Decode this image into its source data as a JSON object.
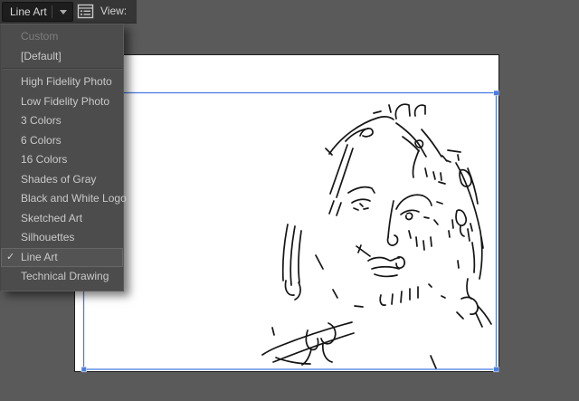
{
  "toolbar": {
    "preset_value": "Line Art",
    "view_label": "View:"
  },
  "menu": {
    "items": [
      {
        "label": "Custom",
        "disabled": true
      },
      {
        "label": "[Default]"
      },
      {
        "separator": true
      },
      {
        "label": "High Fidelity Photo"
      },
      {
        "label": "Low Fidelity Photo"
      },
      {
        "label": "3 Colors"
      },
      {
        "label": "6 Colors"
      },
      {
        "label": "16 Colors"
      },
      {
        "label": "Shades of Gray"
      },
      {
        "label": "Black and White Logo"
      },
      {
        "label": "Sketched Art"
      },
      {
        "label": "Silhouettes"
      },
      {
        "label": "Line Art",
        "checked": true,
        "selected": true
      },
      {
        "label": "Technical Drawing"
      }
    ],
    "checkmark_glyph": "✓"
  },
  "icons": {
    "panel_icon": "image-trace-panel-icon",
    "dropdown_arrow": "chevron-down-icon"
  },
  "colors": {
    "selection_blue": "#4a7de2",
    "canvas_gray": "#5a5a5a",
    "toolbar_bg": "#363636",
    "menu_bg": "#4c4c4c",
    "artboard_white": "#ffffff",
    "sketch_ink": "#151515"
  },
  "canvas": {
    "sketch_paths": [
      "M364,170 C377,151 398,136 418,130 C425,128 431,129 435,132",
      "M360,164 L367,171",
      "M382,156 C390,147 400,143 407,142",
      "M398,150 C401,142 410,139 412,145 C413,150 405,152 401,150",
      "M413,125 L421,123",
      "M430,116 L432,124",
      "M438,131 C435,119 444,113 452,116 L453,128",
      "M459,128 C457,119 464,114 470,117 L470,126",
      "M438,136 C448,143 458,152 464,161 C467,166 469,170 471,173",
      "M445,151 C452,156 459,162 463,167",
      "M459,157 C464,153 469,156 467,161 C465,165 460,163 459,158",
      "M466,143 C474,152 482,163 488,173",
      "M489,172 L494,178",
      "M463,166 C459,176 455,186 457,196",
      "M470,186 L472,195",
      "M479,190 L481,198",
      "M487,191 L488,199",
      "M485,201 L492,203",
      "M493,177 L498,179",
      "M495,166 L509,168",
      "M506,171 L507,177",
      "M504,180 C514,197 525,226 531,256 C534,276 533,293 530,308",
      "M509,188 C515,186 521,193 521,201 C520,207 513,208 510,202 C508,196 507,191 509,188",
      "M517,186 C522,198 526,212 528,225",
      "M505,233 C503,240 504,247 509,249 C514,250 517,244 514,238 C512,232 507,231 505,233",
      "M509,250 C508,256 510,260 513,261",
      "M500,243 L501,252",
      "M520,247 L522,255",
      "M517,253 L519,266",
      "M522,268 C524,279 525,291 524,301",
      "M506,288 L507,296",
      "M532,262 L534,274",
      "M384,160 L365,214",
      "M390,164 L372,218",
      "M369,222 L364,236",
      "M377,224 L372,238",
      "M318,248 C314,268 312,290 313,310",
      "M326,250 C322,272 320,295 322,315",
      "M333,255 C330,276 329,296 331,312",
      "M316,310 C314,320 318,327 325,326",
      "M330,312 C334,320 332,328 326,331",
      "M349,282 L357,297",
      "M368,320 L373,329",
      "M385,213 C394,207 404,205 411,208 L414,213",
      "M389,224 C395,220 403,219 409,222",
      "M398,225 L401,228",
      "M391,230 L396,232",
      "M402,231 L407,230",
      "M438,231 C443,220 455,213 467,216 C472,218 476,222 477,227",
      "M443,237 C449,232 457,231 463,234",
      "M450,236 C454,234 457,237 455,241 C452,244 448,242 449,238",
      "M469,240 L474,241",
      "M483,223 L489,225",
      "M480,243 L484,248",
      "M435,222 C432,236 430,250 429,262",
      "M429,262 C427,269 432,273 437,270 C441,267 440,261 436,260",
      "M452,255 L454,263",
      "M460,262 L461,272",
      "M468,266 L469,276",
      "M476,262 L477,272",
      "M496,255 L497,262",
      "M394,272 L409,283",
      "M399,271 L396,279",
      "M407,288 C415,283 424,284 429,287 C433,290 437,284 441,285",
      "M440,284 C446,283 449,289 446,294 C442,298 438,296 438,291",
      "M411,297 C420,294 432,294 441,297",
      "M414,303 C422,306 431,306 439,304",
      "M421,326 C419,333 421,338 426,337",
      "M434,325 L433,336",
      "M444,322 L443,334",
      "M453,319 L453,331",
      "M462,317 L462,329",
      "M474,314 L477,317",
      "M488,327 L492,329",
      "M392,338 L401,339",
      "M517,308 C515,318 516,327 521,330",
      "M510,330 C518,326 526,330 528,338 C529,344 525,348 520,347",
      "M528,338 C534,344 539,351 543,358",
      "M505,345 L512,352",
      "M526,346 L533,361",
      "M340,365 C337,375 338,383 344,386 C350,388 353,381 351,374",
      "M344,386 C342,394 339,400 334,403",
      "M363,357 C370,360 373,368 369,375 C365,382 357,381 355,374",
      "M357,380 C356,390 360,398 367,400",
      "M389,356 C363,363 332,373 305,384 C298,387 293,390 290,392",
      "M391,368 C362,377 330,389 302,400",
      "M305,395 C315,399 330,402 343,402",
      "M301,362 L303,370",
      "M476,393 L482,407"
    ]
  }
}
